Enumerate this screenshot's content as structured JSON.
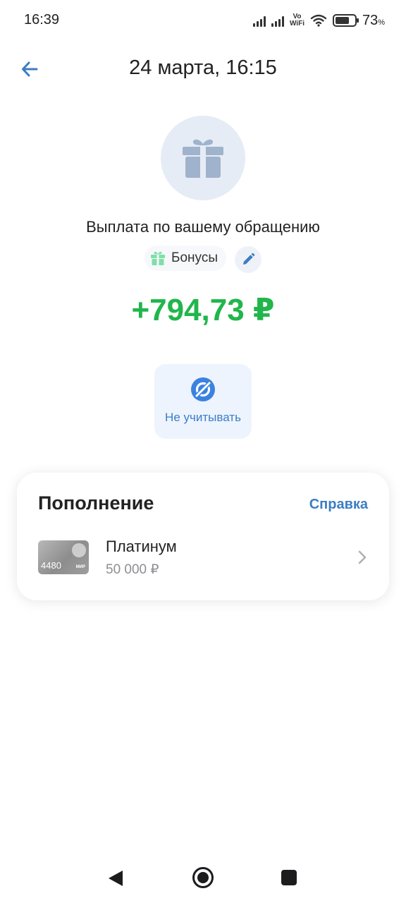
{
  "status_bar": {
    "time": "16:39",
    "vowifi_top": "Vo",
    "vowifi_bottom": "WiFi",
    "battery_percent": "73",
    "battery_unit": "%",
    "battery_level": 0.73
  },
  "header": {
    "back_icon": "arrow-left-icon",
    "title": "24 марта, 16:15"
  },
  "operation": {
    "icon": "gift-icon",
    "title": "Выплата по вашему обращению",
    "category": {
      "icon": "gift-icon",
      "label": "Бонусы"
    },
    "edit_icon": "pencil-icon",
    "amount": "+794,73 ₽",
    "exclude_button": {
      "icon": "eye-off-icon",
      "label": "Не учитывать"
    }
  },
  "details": {
    "title": "Пополнение",
    "help_link": "Справка",
    "account": {
      "card_number": "4480",
      "name": "Платинум",
      "balance": "50 000 ₽"
    }
  },
  "colors": {
    "accent": "#3b7dc4",
    "amount_positive": "#21b64b",
    "category_icon": "#7ee0a6",
    "hero_icon": "#9fb3cc"
  },
  "nav_bar": {
    "back": "triangle-back-icon",
    "home": "circle-home-icon",
    "recents": "square-recents-icon"
  }
}
